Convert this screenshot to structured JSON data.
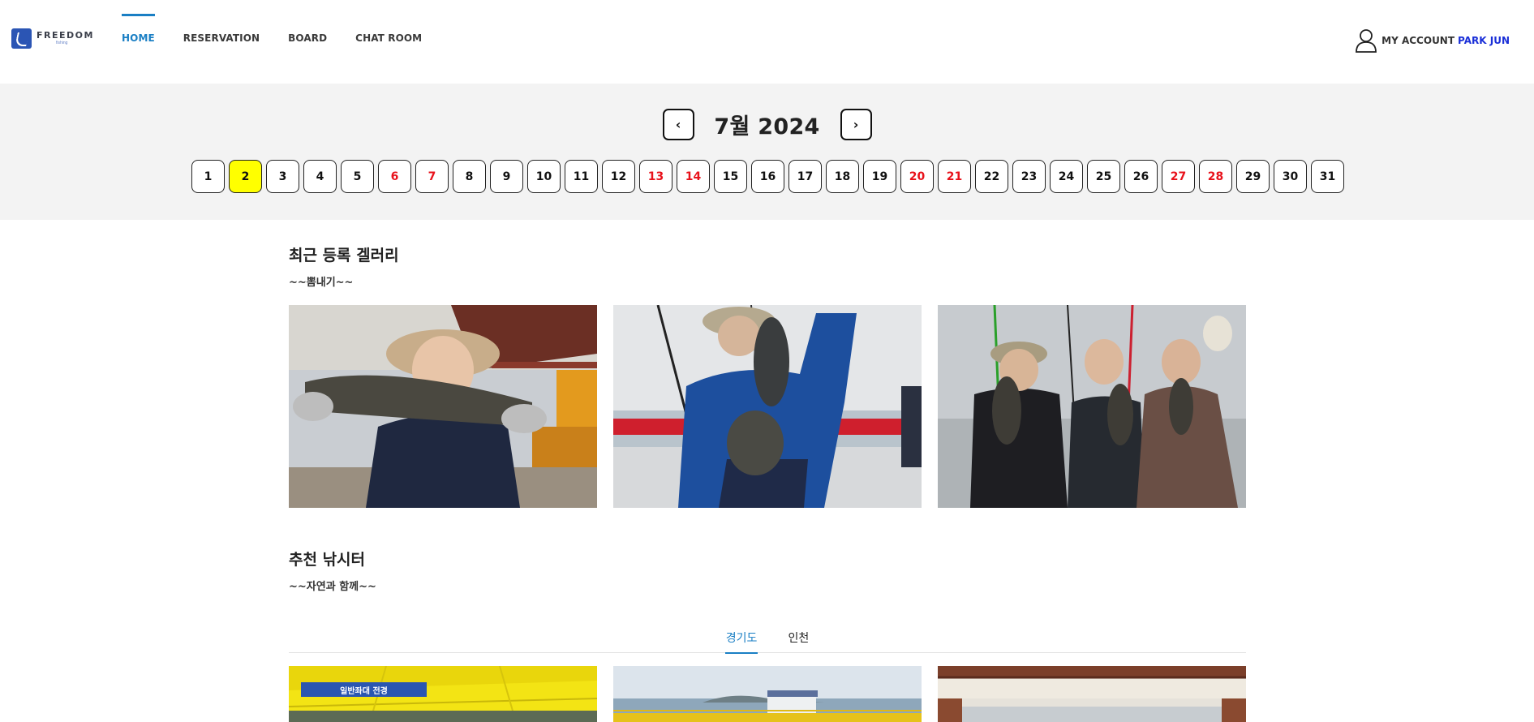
{
  "brand": {
    "name": "FREEDOM",
    "tagline": "fishing"
  },
  "nav": {
    "items": [
      {
        "label": "HOME",
        "active": true
      },
      {
        "label": "RESERVATION",
        "active": false
      },
      {
        "label": "BOARD",
        "active": false
      },
      {
        "label": "CHAT ROOM",
        "active": false
      }
    ]
  },
  "account": {
    "label": "MY ACCOUNT",
    "user_name": "PARK JUN",
    "icon": "user-icon"
  },
  "calendar": {
    "prev_label": "‹",
    "next_label": "›",
    "title": "7월 2024",
    "selected_day": "2",
    "days": [
      "1",
      "2",
      "3",
      "4",
      "5",
      "6",
      "7",
      "8",
      "9",
      "10",
      "11",
      "12",
      "13",
      "14",
      "15",
      "16",
      "17",
      "18",
      "19",
      "20",
      "21",
      "22",
      "23",
      "24",
      "25",
      "26",
      "27",
      "28",
      "29",
      "30",
      "31"
    ],
    "weekend_days": [
      "6",
      "7",
      "13",
      "14",
      "20",
      "21",
      "27",
      "28"
    ],
    "weekend_color": "#e8121b",
    "selected_color": "#ffff00"
  },
  "gallery": {
    "title": "최근 등록 겔러리",
    "subtitle": "~~뽐내기~~"
  },
  "recommend": {
    "title": "추천 낚시터",
    "subtitle": "~~자연과 함께~~",
    "tabs": [
      {
        "label": "경기도",
        "active": true
      },
      {
        "label": "인천",
        "active": false
      }
    ],
    "spot_badge": "일반좌대 전경"
  },
  "colors": {
    "accent": "#1a7fc4",
    "account_name": "#1a2fd8",
    "strip_bg": "#f3f3f3"
  }
}
